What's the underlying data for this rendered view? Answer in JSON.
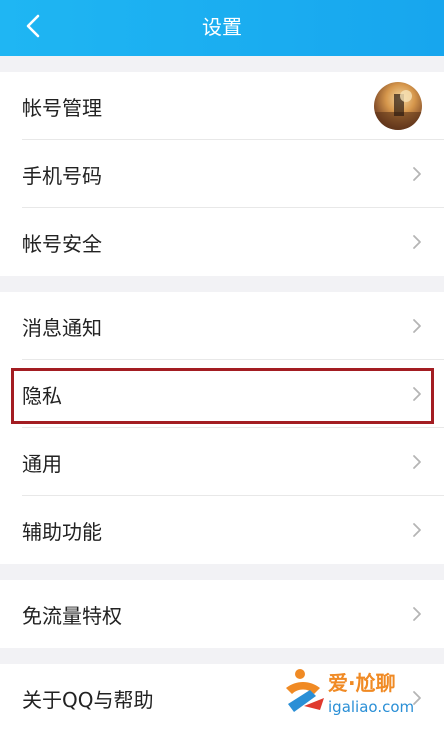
{
  "header": {
    "title": "设置"
  },
  "groups": [
    {
      "items": [
        {
          "label": "帐号管理"
        },
        {
          "label": "手机号码"
        },
        {
          "label": "帐号安全"
        }
      ]
    },
    {
      "items": [
        {
          "label": "消息通知"
        },
        {
          "label": "隐私"
        },
        {
          "label": "通用"
        },
        {
          "label": "辅助功能"
        }
      ]
    },
    {
      "items": [
        {
          "label": "免流量特权"
        }
      ]
    },
    {
      "items": [
        {
          "label": "关于QQ与帮助"
        }
      ]
    }
  ],
  "watermark": {
    "name": "爱·尬聊",
    "url": "igaliao.com"
  },
  "colors": {
    "header": "#17a6ee",
    "highlight_box": "#a31d22"
  }
}
